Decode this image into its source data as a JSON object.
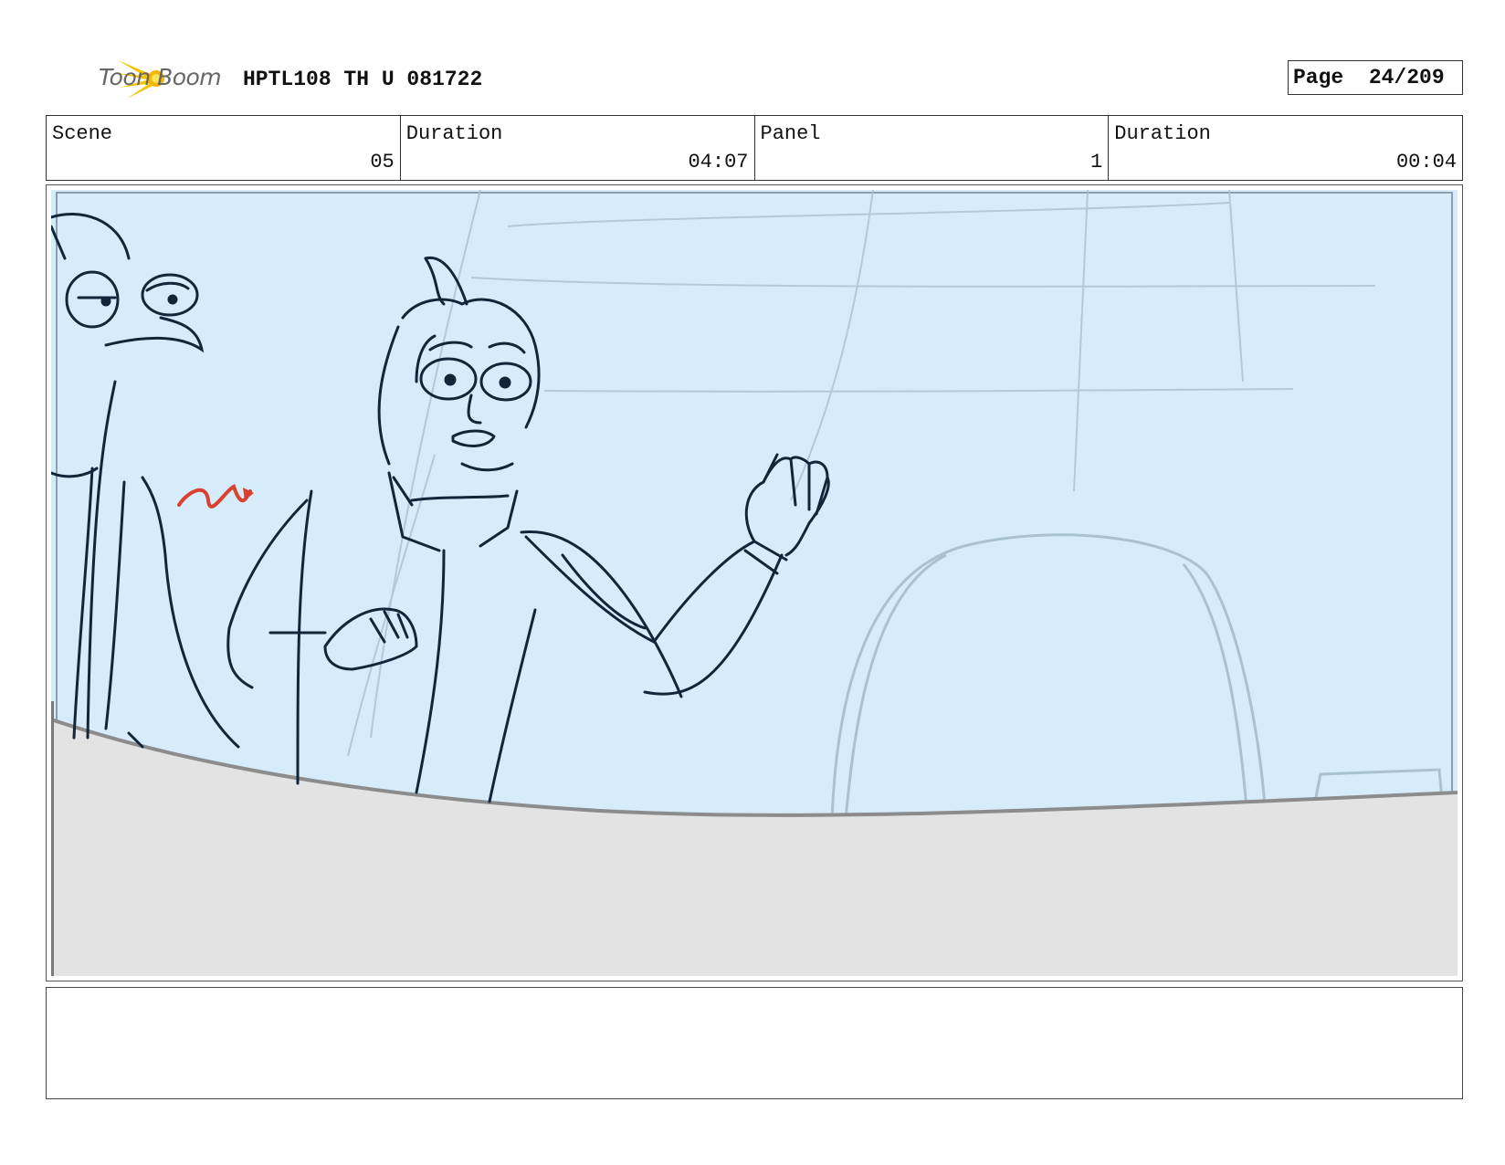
{
  "header": {
    "logo_text": "Toon Boom",
    "doc_title": "HPTL108 TH U 081722",
    "page_label": "Page",
    "page_number": "24/209"
  },
  "info": {
    "scene_label": "Scene",
    "scene_value": "05",
    "scene_duration_label": "Duration",
    "scene_duration_value": "04:07",
    "panel_label": "Panel",
    "panel_value": "1",
    "panel_duration_label": "Duration",
    "panel_duration_value": "00:04"
  },
  "panel": {
    "sky_color": "#d6ecfa",
    "ground_color": "#e3e3e3",
    "ink_color": "#12263a",
    "accent_color": "#d9402e"
  },
  "notes": {
    "text": ""
  }
}
